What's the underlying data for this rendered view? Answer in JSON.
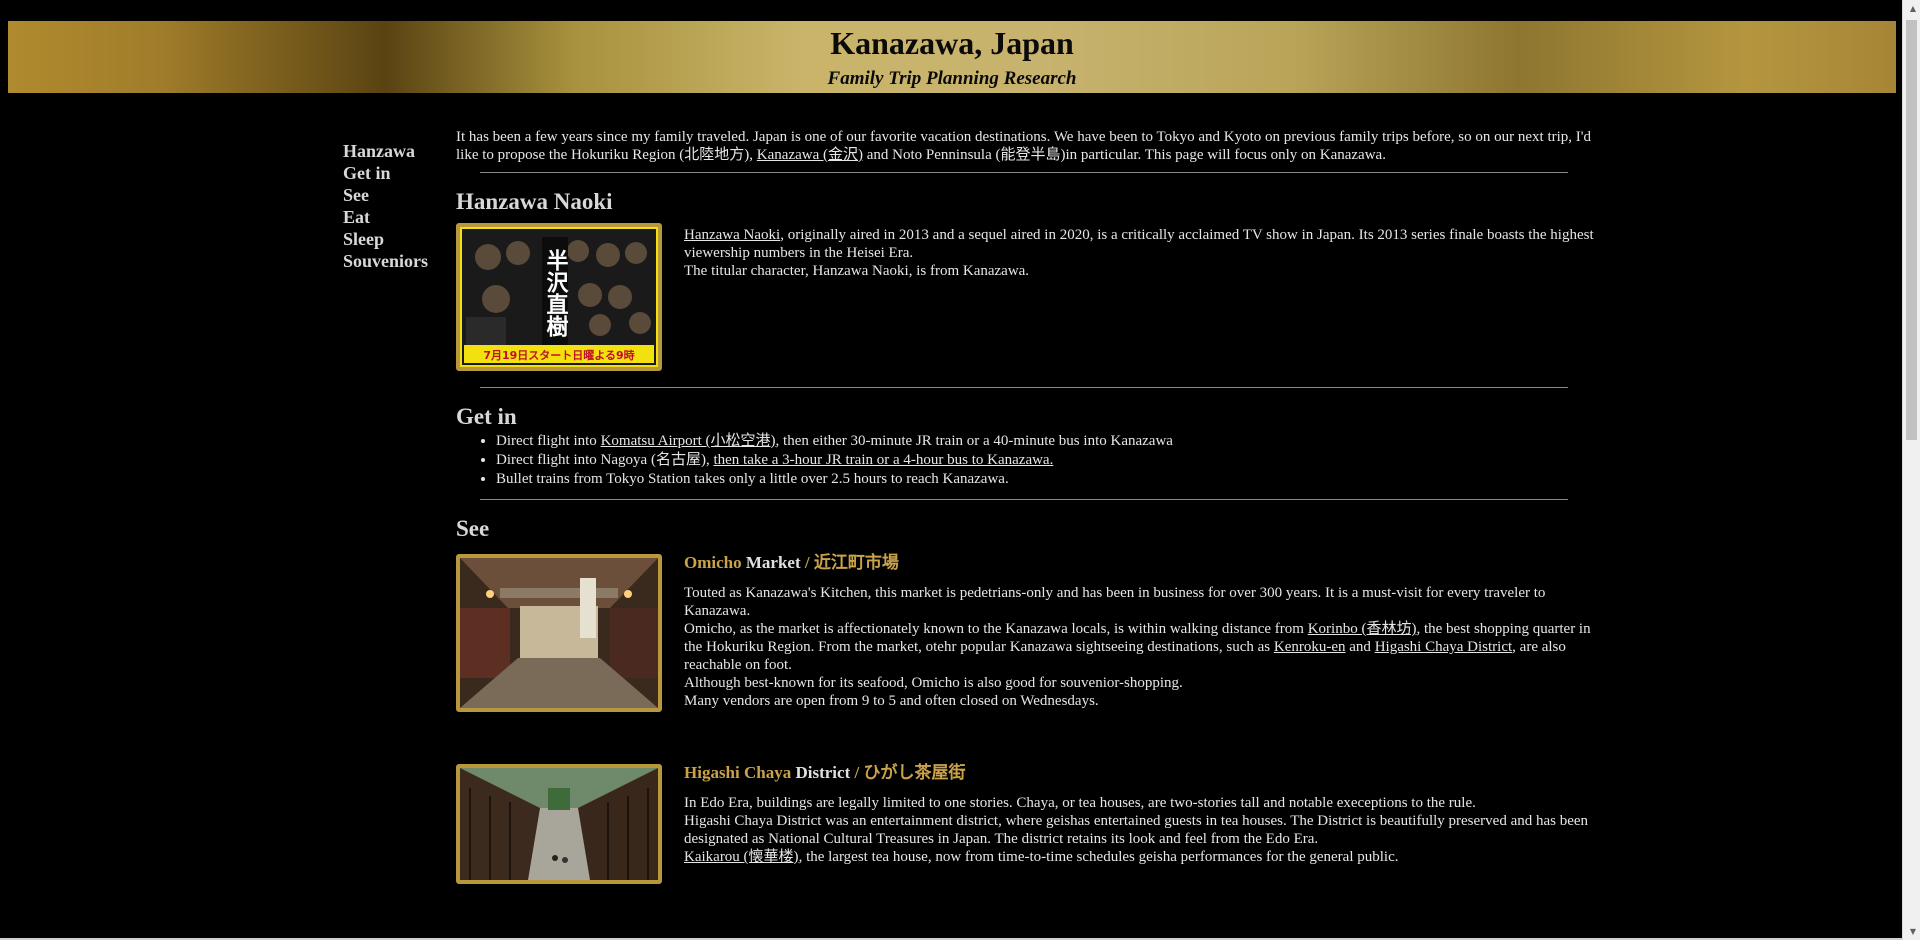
{
  "header": {
    "title": "Kanazawa, Japan",
    "subtitle": "Family Trip Planning Research"
  },
  "nav": [
    "Hanzawa",
    "Get in",
    "See",
    "Eat",
    "Sleep",
    "Souveniors"
  ],
  "intro": {
    "part1": "It has been a few years since my family traveled. Japan is one of our favorite vacation destinations. We have been to Tokyo and Kyoto on previous family trips before, so on our next trip, I'd like to propose the Hokuriku Region (北陸地方), ",
    "link": "Kanazawa (金沢)",
    "part2": " and Noto Penninsula (能登半島)in particular. This page will focus only on Kanazawa."
  },
  "hanzawa": {
    "heading": "Hanzawa Naoki",
    "link": "Hanzawa Naoki",
    "p1_rest": ", originally aired in 2013 and a sequel aired in 2020, is a critically acclaimed TV show in Japan. Its 2013 series finale boasts the highest viewership numbers in the Heisei Era.",
    "p2": "The titular character, Hanzawa Naoki, is from Kanazawa.",
    "poster_title": "半沢直樹",
    "poster_caption": "7月19日スタート日曜よる9時"
  },
  "getin": {
    "heading": "Get in",
    "item1_pre": "Direct flight into ",
    "item1_link": "Komatsu Airport (小松空港)",
    "item1_post": ", then either 30-minute JR train or a 40-minute bus into Kanazawa",
    "item2_pre": "Direct flight into Nagoya (名古屋), ",
    "item2_link": "then take a 3-hour JR train or a 4-hour bus to Kanazawa.",
    "item3": "Bullet trains from Tokyo Station takes only a little over 2.5 hours to reach Kanazawa."
  },
  "see": {
    "heading": "See",
    "omicho": {
      "title_gold": "Omicho",
      "title_white": " Market",
      "title_jp": " / 近江町市場",
      "p1": "Touted as Kanazawa's Kitchen, this market is pedetrians-only and has been in business for over 300 years. It is a must-visit for every traveler to Kanazawa.",
      "p2_pre": "Omicho, as the market is affectionately known to the Kanazawa locals, is within walking distance from ",
      "p2_link1": "Korinbo (香林坊)",
      "p2_mid": ", the best shopping quarter in the Hokuriku Region. From the market, otehr popular Kanazawa sightseeing destinations, such as ",
      "p2_link2": "Kenroku-en",
      "p2_and": " and ",
      "p2_link3": "Higashi Chaya District",
      "p2_post": ", are also reachable on foot.",
      "p3": "Although best-known for its seafood, Omicho is also good for souvenior-shopping.",
      "p4": "Many vendors are open from 9 to 5 and often closed on Wednesdays."
    },
    "higashi": {
      "title_gold": "Higashi Chaya",
      "title_white": " District",
      "title_jp": " / ひがし茶屋街",
      "p1": "In Edo Era, buildings are legally limited to one stories. Chaya, or tea houses, are two-stories tall and notable execeptions to the rule.",
      "p2": "Higashi Chaya District was an entertainment district, where geishas entertained guests in tea houses. The District is beautifully preserved and has been designated as National Cultural Treasures in Japan. The district retains its look and feel from the Edo Era.",
      "p3_link": "Kaikarou (懐華楼)",
      "p3_post": ", the largest tea house, now from time-to-time schedules geisha performances for the general public."
    }
  }
}
